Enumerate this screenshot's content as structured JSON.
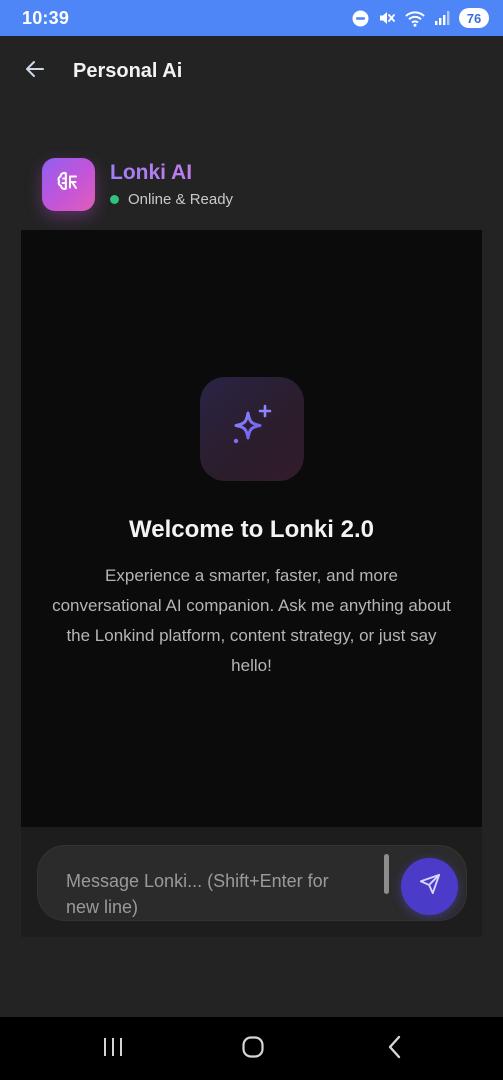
{
  "status_bar": {
    "time": "10:39",
    "battery": "76",
    "icons": [
      "do-not-disturb-icon",
      "mute-icon",
      "wifi-icon",
      "signal-icon",
      "battery-icon"
    ]
  },
  "app_bar": {
    "back_icon": "arrow-left-icon",
    "title": "Personal Ai"
  },
  "chat_header": {
    "avatar_icon": "brain-icon",
    "name": "Lonki AI",
    "status": "Online & Ready",
    "status_color": "#2ec27e"
  },
  "welcome": {
    "icon": "sparkles-icon",
    "title": "Welcome to Lonki 2.0",
    "description": "Experience a smarter, faster, and more conversational AI companion. Ask me anything about the Lonkind platform, content strategy, or just say hello!"
  },
  "composer": {
    "placeholder": "Message Lonki... (Shift+Enter for new line)",
    "value": "",
    "send_icon": "send-icon",
    "accent": "#4a3cc9"
  },
  "nav_bar": {
    "buttons": [
      "recent-apps-icon",
      "home-icon",
      "back-icon"
    ]
  },
  "colors": {
    "status_bar": "#4f86f7",
    "background": "#232323",
    "chat_panel": "#0b0b0b",
    "brand_gradient": [
      "#8f5ff2",
      "#e15db7"
    ]
  }
}
